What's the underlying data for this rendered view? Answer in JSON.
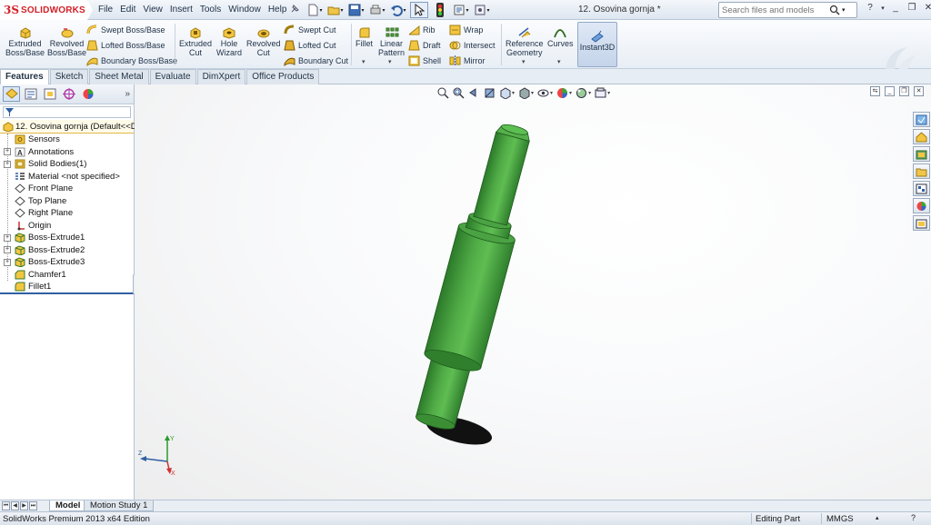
{
  "app": {
    "logo_mark": "3S",
    "logo_text": "SOLIDWORKS",
    "document_title": "12. Osovina gornja *"
  },
  "menu": [
    "File",
    "Edit",
    "View",
    "Insert",
    "Tools",
    "Window",
    "Help"
  ],
  "search": {
    "placeholder": "Search files and models"
  },
  "command_manager": {
    "extruded_boss": [
      "Extruded",
      "Boss/Base"
    ],
    "revolved_boss": [
      "Revolved",
      "Boss/Base"
    ],
    "swept_boss": "Swept Boss/Base",
    "lofted_boss": "Lofted Boss/Base",
    "boundary_boss": "Boundary Boss/Base",
    "extruded_cut": [
      "Extruded",
      "Cut"
    ],
    "hole_wizard": [
      "Hole",
      "Wizard"
    ],
    "revolved_cut": [
      "Revolved",
      "Cut"
    ],
    "swept_cut": "Swept Cut",
    "lofted_cut": "Lofted Cut",
    "boundary_cut": "Boundary Cut",
    "fillet": "Fillet",
    "linear_pattern": [
      "Linear",
      "Pattern"
    ],
    "rib": "Rib",
    "draft": "Draft",
    "shell": "Shell",
    "wrap": "Wrap",
    "intersect": "Intersect",
    "mirror": "Mirror",
    "reference_geometry": [
      "Reference",
      "Geometry"
    ],
    "curves": "Curves",
    "instant3d": "Instant3D"
  },
  "tabs": [
    "Features",
    "Sketch",
    "Sheet Metal",
    "Evaluate",
    "DimXpert",
    "Office Products"
  ],
  "active_tab": "Features",
  "feature_tree": {
    "root": "12. Osovina gornja  (Default<<D",
    "items": [
      {
        "label": "Sensors",
        "icon": "sensor-icon",
        "expandable": false
      },
      {
        "label": "Annotations",
        "icon": "annotations-icon",
        "expandable": true
      },
      {
        "label": "Solid Bodies(1)",
        "icon": "solid-bodies-icon",
        "expandable": true
      },
      {
        "label": "Material <not specified>",
        "icon": "material-icon",
        "expandable": false
      },
      {
        "label": "Front Plane",
        "icon": "plane-icon",
        "expandable": false
      },
      {
        "label": "Top Plane",
        "icon": "plane-icon",
        "expandable": false
      },
      {
        "label": "Right Plane",
        "icon": "plane-icon",
        "expandable": false
      },
      {
        "label": "Origin",
        "icon": "origin-icon",
        "expandable": false
      },
      {
        "label": "Boss-Extrude1",
        "icon": "extrude-feature-icon",
        "expandable": true
      },
      {
        "label": "Boss-Extrude2",
        "icon": "extrude-feature-icon",
        "expandable": true
      },
      {
        "label": "Boss-Extrude3",
        "icon": "extrude-feature-icon",
        "expandable": true
      },
      {
        "label": "Chamfer1",
        "icon": "chamfer-icon",
        "expandable": false
      },
      {
        "label": "Fillet1",
        "icon": "fillet-feature-icon",
        "expandable": false
      }
    ]
  },
  "bottom_tabs": [
    "Model",
    "Motion Study 1"
  ],
  "status": {
    "edition": "SolidWorks Premium 2013 x64 Edition",
    "mode": "Editing Part",
    "units": "MMGS",
    "help": "?"
  },
  "colors": {
    "part_green": "#3f9a3a",
    "accent_blue": "#2f5fa3",
    "logo_red": "#d21f26"
  }
}
